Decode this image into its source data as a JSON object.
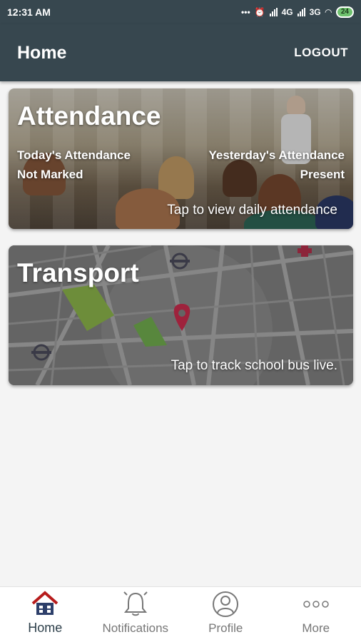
{
  "status_bar": {
    "time": "12:31 AM",
    "network_1": "4G",
    "network_2": "3G",
    "battery": "24"
  },
  "app_bar": {
    "title": "Home",
    "logout_label": "LOGOUT"
  },
  "attendance_card": {
    "title": "Attendance",
    "today_label": "Today's Attendance",
    "today_value": "Not Marked",
    "yesterday_label": "Yesterday's Attendance",
    "yesterday_value": "Present",
    "hint": "Tap to view daily attendance"
  },
  "transport_card": {
    "title": "Transport",
    "hint": "Tap to track school bus live."
  },
  "bottom_nav": {
    "items": [
      {
        "label": "Home",
        "icon": "home-icon",
        "active": true
      },
      {
        "label": "Notifications",
        "icon": "bell-icon",
        "active": false
      },
      {
        "label": "Profile",
        "icon": "profile-icon",
        "active": false
      },
      {
        "label": "More",
        "icon": "more-icon",
        "active": false
      }
    ]
  },
  "colors": {
    "app_bar": "#37474f",
    "pin": "#b71c3c",
    "park": "#6a9a3a",
    "active_nav": "#2d3f4a"
  }
}
